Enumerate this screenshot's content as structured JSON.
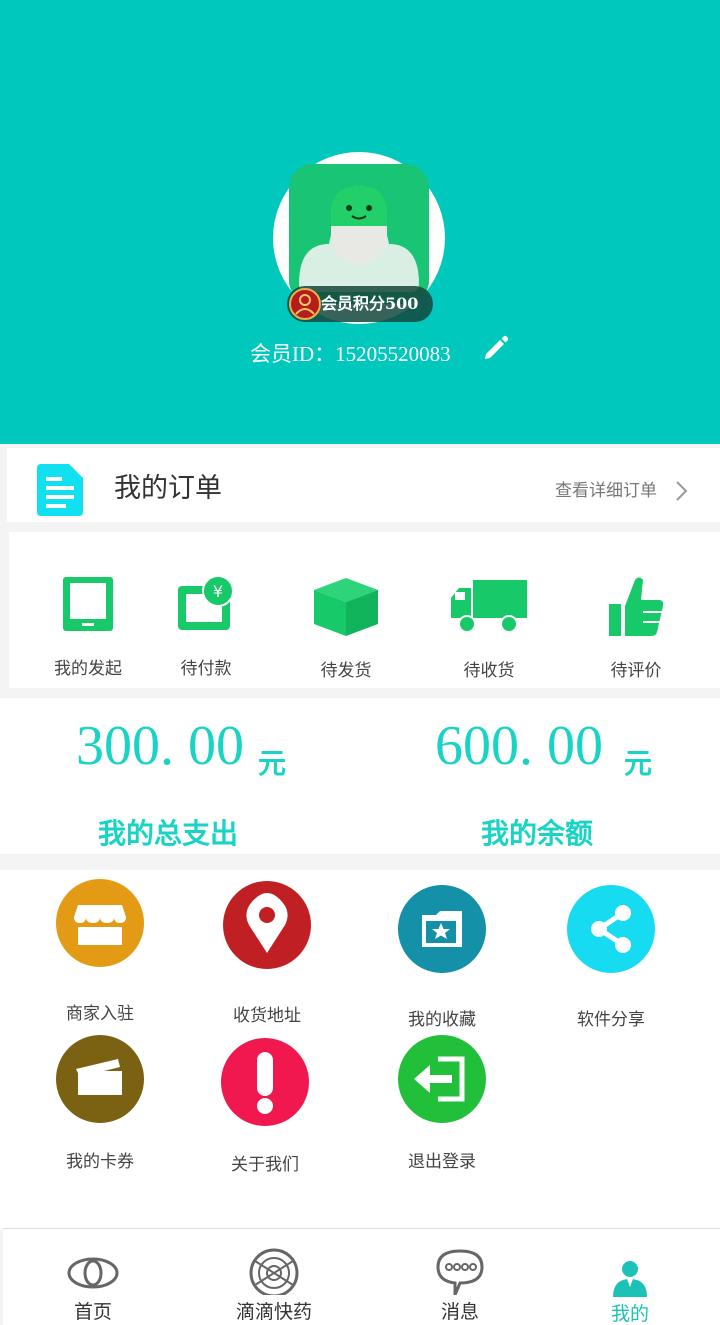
{
  "colors": {
    "brand": "#00c8bd",
    "accent": "#19d3c5",
    "icon_green": "#17c968",
    "merchant": "#e39a14",
    "address": "#c02024",
    "favorites": "#1491a8",
    "share": "#17dbf0",
    "coupons": "#7a6212",
    "about": "#f0184e",
    "logout": "#22c03a"
  },
  "profile": {
    "points_label": "会员积分500",
    "member_id": "会员ID：15205520083",
    "avatar_icon": "avatar-capsule-icon",
    "edit_icon": "pencil-icon"
  },
  "orders": {
    "title": "我的订单",
    "more_label": "查看详细订单",
    "statuses": [
      {
        "label": "我的发起",
        "icon": "tablet-icon"
      },
      {
        "label": "待付款",
        "icon": "wallet-yen-icon"
      },
      {
        "label": "待发货",
        "icon": "box-icon"
      },
      {
        "label": "待收货",
        "icon": "truck-icon"
      },
      {
        "label": "待评价",
        "icon": "thumbs-up-icon"
      }
    ]
  },
  "money": {
    "spent_amount": "300. 00",
    "spent_unit": "元",
    "spent_label": "我的总支出",
    "balance_amount": "600. 00",
    "balance_unit": "元",
    "balance_label": "我的余额"
  },
  "services": [
    {
      "label": "商家入驻",
      "icon": "storefront-icon"
    },
    {
      "label": "收货地址",
      "icon": "map-pin-icon"
    },
    {
      "label": "我的收藏",
      "icon": "star-folder-icon"
    },
    {
      "label": "软件分享",
      "icon": "share-icon"
    },
    {
      "label": "我的卡券",
      "icon": "card-icon"
    },
    {
      "label": "关于我们",
      "icon": "exclamation-icon"
    },
    {
      "label": "退出登录",
      "icon": "logout-icon"
    }
  ],
  "tabs": [
    {
      "label": "首页",
      "icon": "eye-icon",
      "active": false
    },
    {
      "label": "滴滴快药",
      "icon": "radar-icon",
      "active": false
    },
    {
      "label": "消息",
      "icon": "chat-bubble-icon",
      "active": false
    },
    {
      "label": "我的",
      "icon": "user-icon",
      "active": true
    }
  ]
}
